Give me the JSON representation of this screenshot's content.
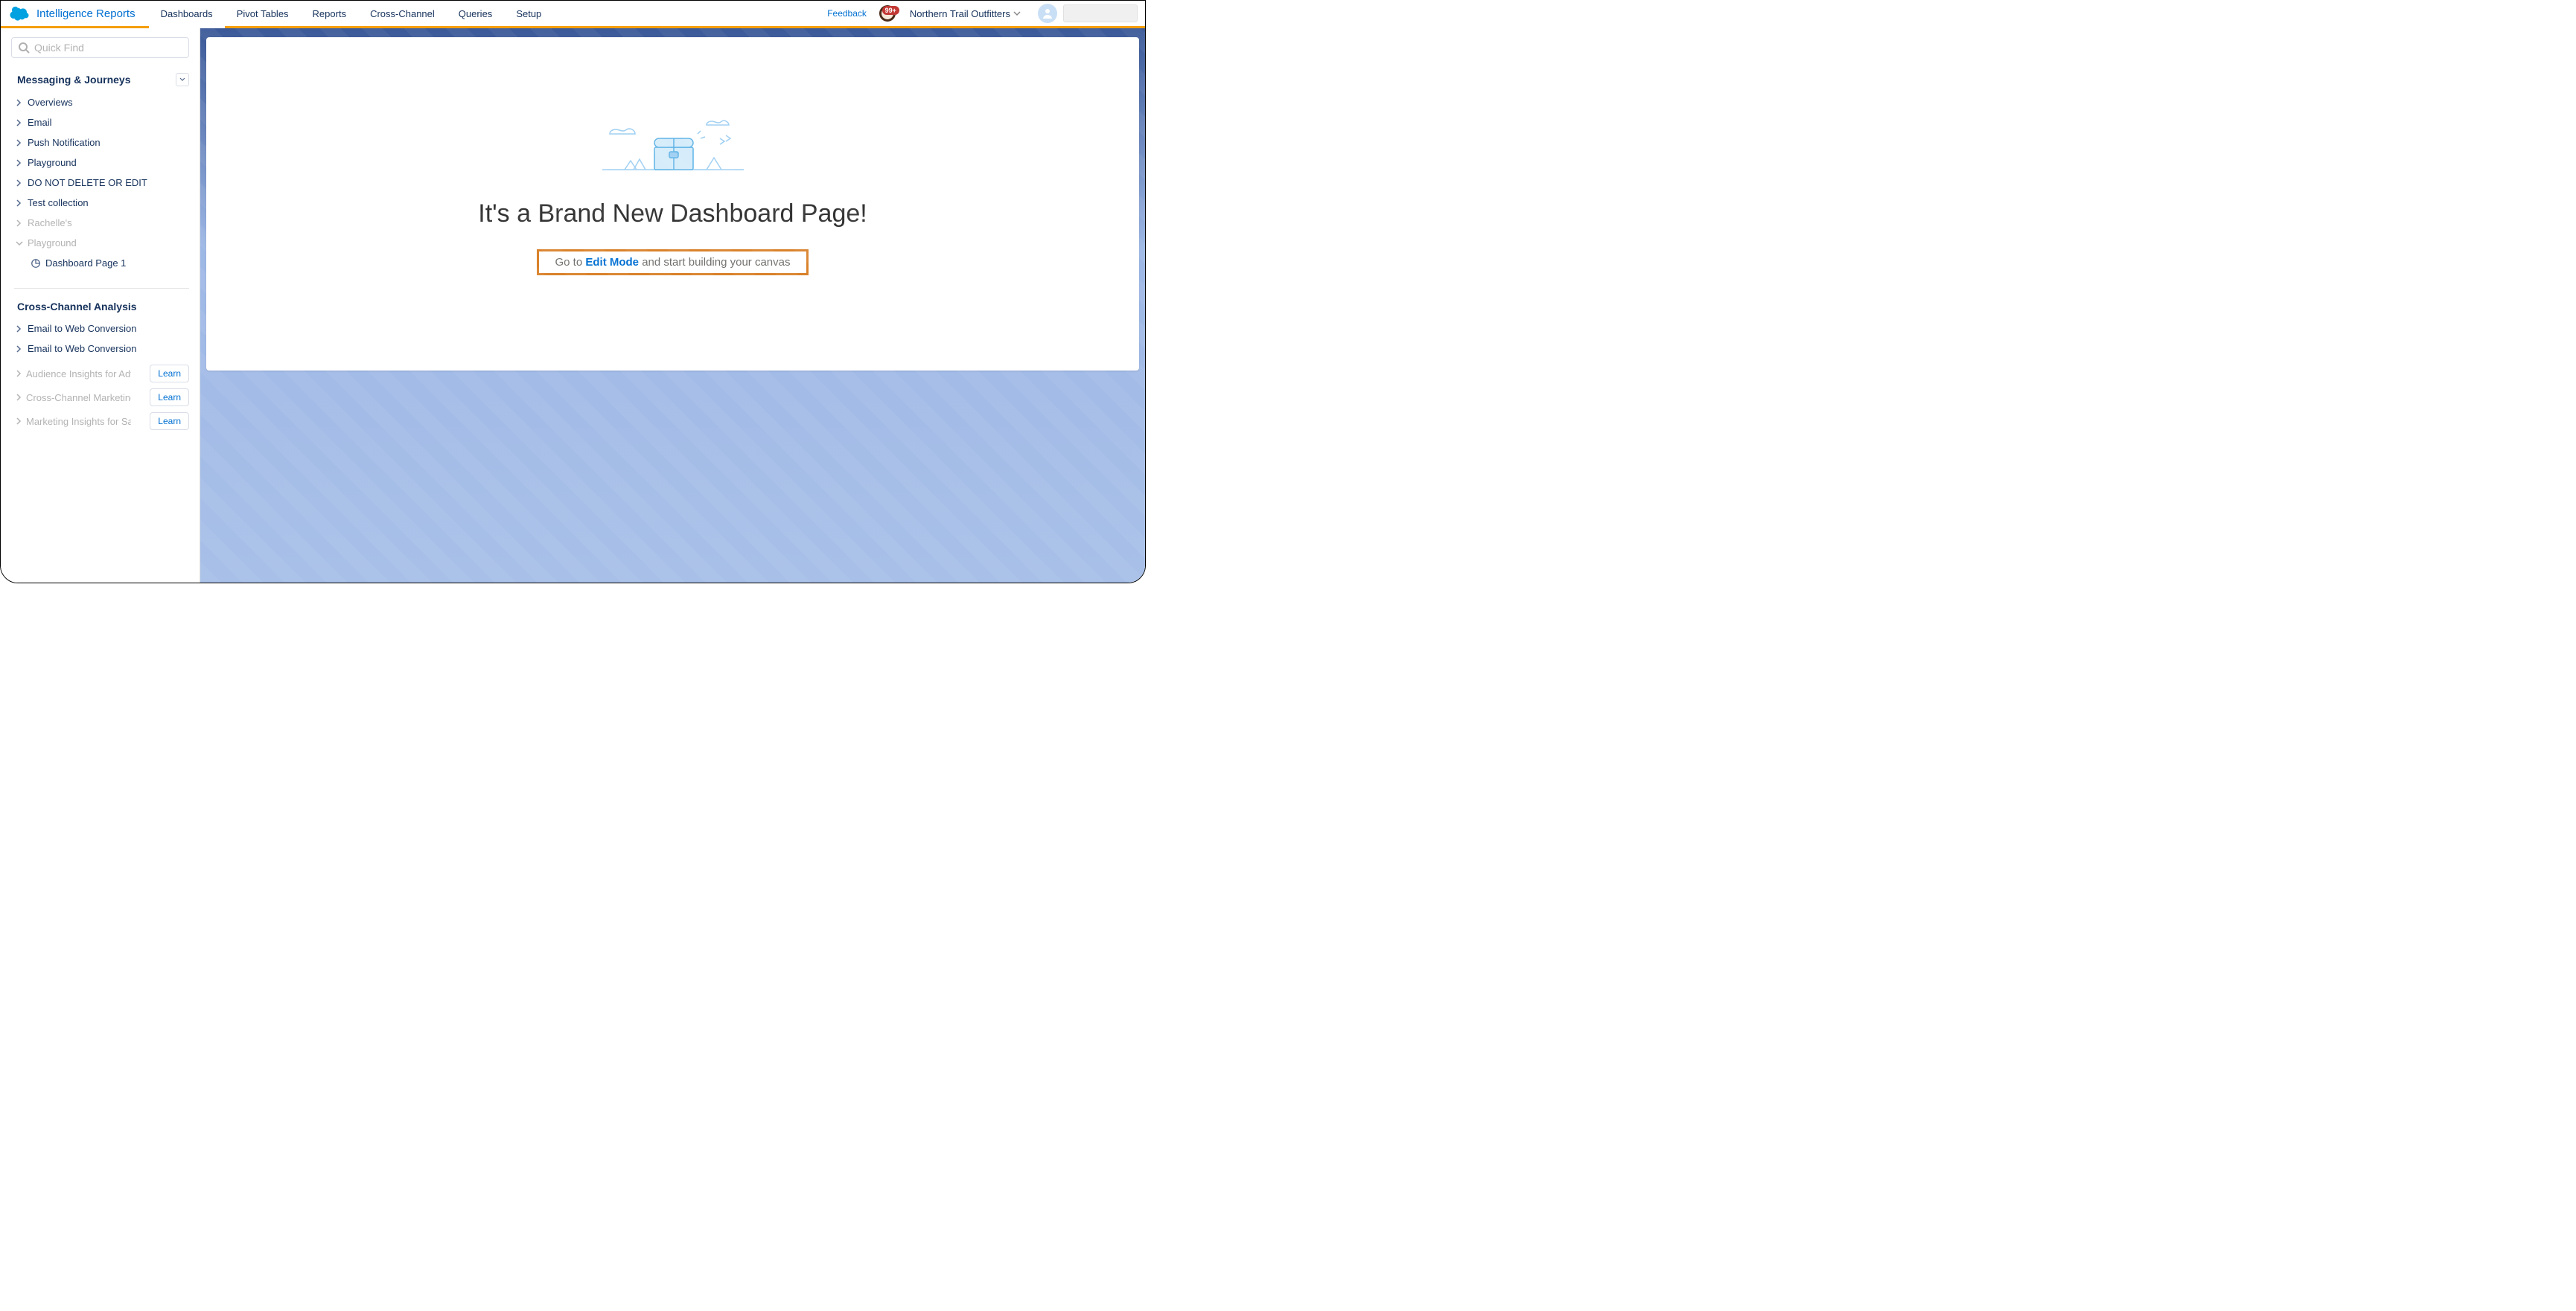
{
  "header": {
    "brand": "Intelligence Reports",
    "tabs": [
      "Dashboards",
      "Pivot Tables",
      "Reports",
      "Cross-Channel",
      "Queries",
      "Setup"
    ],
    "active_tab": 0,
    "feedback": "Feedback",
    "notif_count": "99+",
    "org_name": "Northern Trail Outfitters"
  },
  "sidebar": {
    "quick_find_placeholder": "Quick Find",
    "section1_title": "Messaging & Journeys",
    "section1_items": [
      {
        "label": "Overviews",
        "muted": false,
        "expanded": false
      },
      {
        "label": "Email",
        "muted": false,
        "expanded": false
      },
      {
        "label": "Push Notification",
        "muted": false,
        "expanded": false
      },
      {
        "label": "Playground",
        "muted": false,
        "expanded": false
      },
      {
        "label": "DO NOT DELETE OR EDIT",
        "muted": false,
        "expanded": false
      },
      {
        "label": "Test collection",
        "muted": false,
        "expanded": false
      },
      {
        "label": "Rachelle's",
        "muted": true,
        "expanded": false
      },
      {
        "label": "Playground",
        "muted": true,
        "expanded": true
      }
    ],
    "section1_sub": "Dashboard Page 1",
    "section2_title": "Cross-Channel Analysis",
    "section2_items": [
      {
        "label": "Email to Web Conversion"
      },
      {
        "label": "Email to Web Conversion"
      }
    ],
    "section2_learn_items": [
      {
        "label": "Audience Insights for Adv…",
        "btn": "Learn"
      },
      {
        "label": "Cross-Channel Marketing …",
        "btn": "Learn"
      },
      {
        "label": "Marketing Insights for Sal…",
        "btn": "Learn"
      }
    ]
  },
  "canvas": {
    "title": "It's a Brand New Dashboard Page!",
    "cta_pre": "Go to ",
    "cta_link": "Edit Mode",
    "cta_post": " and start building your canvas"
  }
}
